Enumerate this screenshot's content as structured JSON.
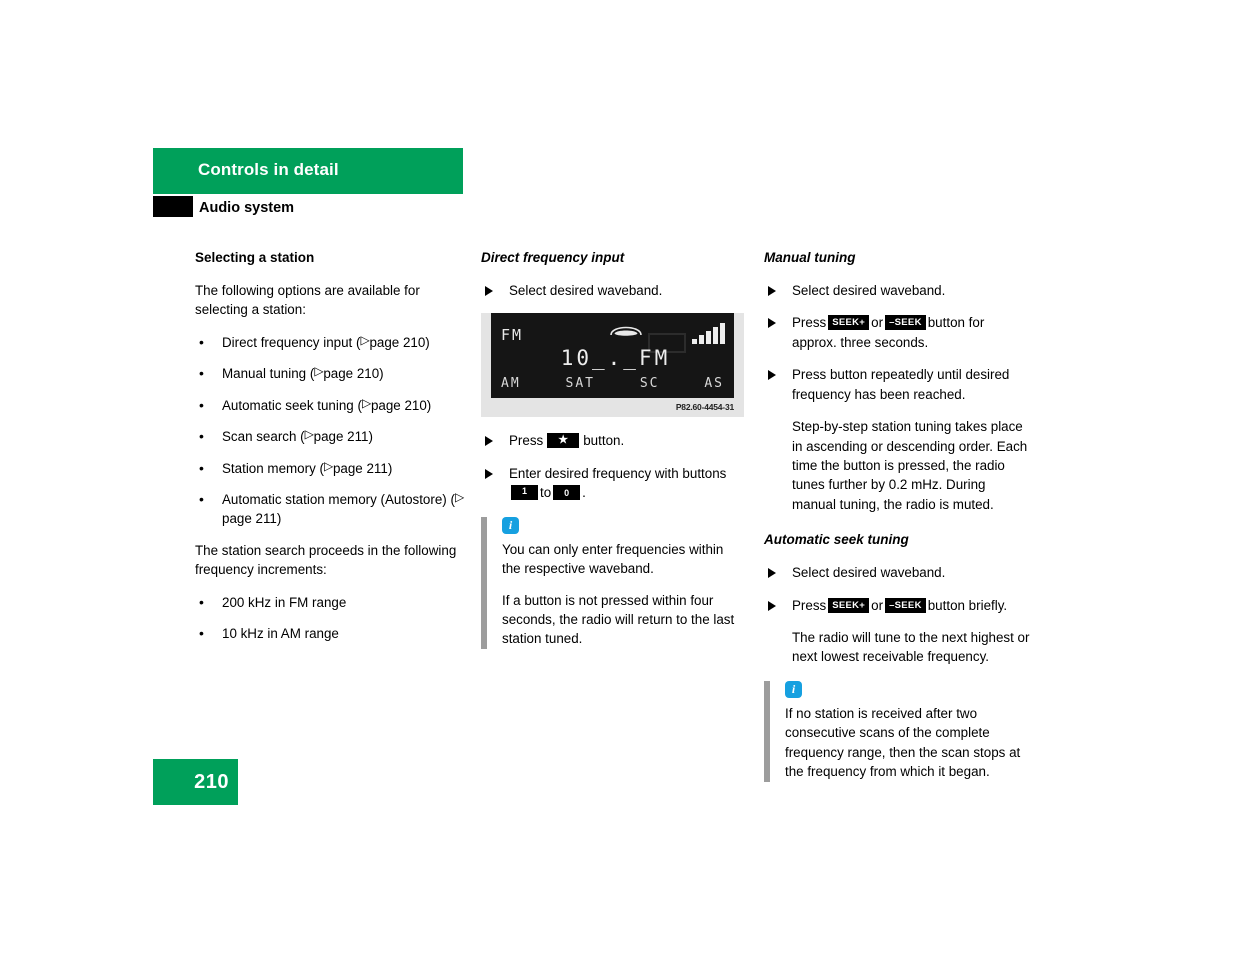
{
  "header": {
    "chapter_title": "Controls in detail",
    "section_title": "Audio system"
  },
  "page_number": "210",
  "left_column": {
    "title": "Selecting a station",
    "intro": "The following options are available for selecting a station:",
    "options": [
      {
        "text": "Direct frequency input (",
        "ref": "page 210",
        "tail": ")"
      },
      {
        "text": "Manual tuning (",
        "ref": "page 210",
        "tail": ")"
      },
      {
        "text": "Automatic seek tuning (",
        "ref": "page 210",
        "tail": ")"
      },
      {
        "text": "Scan search (",
        "ref": "page 211",
        "tail": ")"
      },
      {
        "text": "Station memory (",
        "ref": "page 211",
        "tail": ")"
      },
      {
        "text": "Automatic station memory (Autostore) (",
        "ref": "page 211",
        "tail": ")"
      }
    ],
    "increments_intro": "The station search proceeds in the following frequency increments:",
    "increments": [
      "200 kHz in FM range",
      " 10 kHz in AM range"
    ]
  },
  "middle_column": {
    "title": "Direct frequency input",
    "step_select_waveband": "Select desired waveband.",
    "figure": {
      "caption": "P82.60-4454-31",
      "display": {
        "band": "FM",
        "frequency": "10_._FM",
        "labels": [
          "AM",
          "SAT",
          "SC",
          "AS"
        ],
        "phone_icon": "phone-handset-icon",
        "signal_icon": "signal-bars-icon",
        "signal_bars": 5
      }
    },
    "step_press_prefix": "Press",
    "key_star": "★",
    "step_press_suffix": "button.",
    "step_enter_prefix": "Enter desired frequency with buttons",
    "key_one": "1",
    "key_to": "to",
    "key_zero": "0",
    "step_enter_suffix": ".",
    "info": {
      "icon": "info-icon",
      "paragraphs": [
        "You can only enter frequencies within the respective waveband.",
        "If a button is not pressed within four seconds, the radio will return to the last station tuned."
      ]
    }
  },
  "right_column": {
    "manual_tuning": {
      "title": "Manual tuning",
      "step_select_waveband": "Select desired waveband.",
      "press_prefix": "Press",
      "key_seek_plus": "SEEK+",
      "or": "or",
      "key_seek_minus": "–SEEK",
      "press_suffix": "button for approx. three seconds.",
      "step_repeat": "Press button repeatedly until desired frequency has been reached.",
      "note": "Step-by-step station tuning takes place in ascending or descending order. Each time the button is pressed, the radio tunes further by 0.2 mHz. During manual tuning, the radio is muted."
    },
    "automatic_seek": {
      "title": "Automatic seek tuning",
      "step_select_waveband": "Select desired waveband.",
      "press_prefix": "Press",
      "key_seek_plus": "SEEK+",
      "or": "or",
      "key_seek_minus": "–SEEK",
      "press_suffix": "button briefly.",
      "note": "The radio will tune to the next highest or next lowest receivable frequency.",
      "info": {
        "icon": "info-icon",
        "paragraphs": [
          "If no station is received after two consecutive scans of the complete frequency range, then the scan stops at the frequency from which it began."
        ]
      }
    }
  },
  "colors": {
    "brand_green": "#00a05a",
    "info_blue": "#16a0e0",
    "rule_gray": "#9d9d9d"
  }
}
